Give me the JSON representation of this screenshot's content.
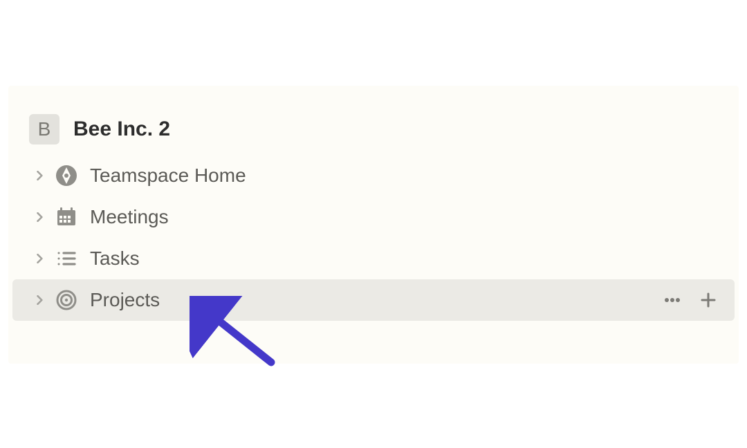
{
  "workspace": {
    "badge_letter": "B",
    "title": "Bee Inc. 2"
  },
  "sidebar": {
    "items": [
      {
        "label": "Teamspace Home",
        "icon": "compass",
        "hovered": false
      },
      {
        "label": "Meetings",
        "icon": "calendar",
        "hovered": false
      },
      {
        "label": "Tasks",
        "icon": "list",
        "hovered": false
      },
      {
        "label": "Projects",
        "icon": "target",
        "hovered": true
      }
    ]
  },
  "colors": {
    "panel_bg": "#fdfcf7",
    "hover_bg": "#ebeae5",
    "arrow": "#4438c9"
  }
}
